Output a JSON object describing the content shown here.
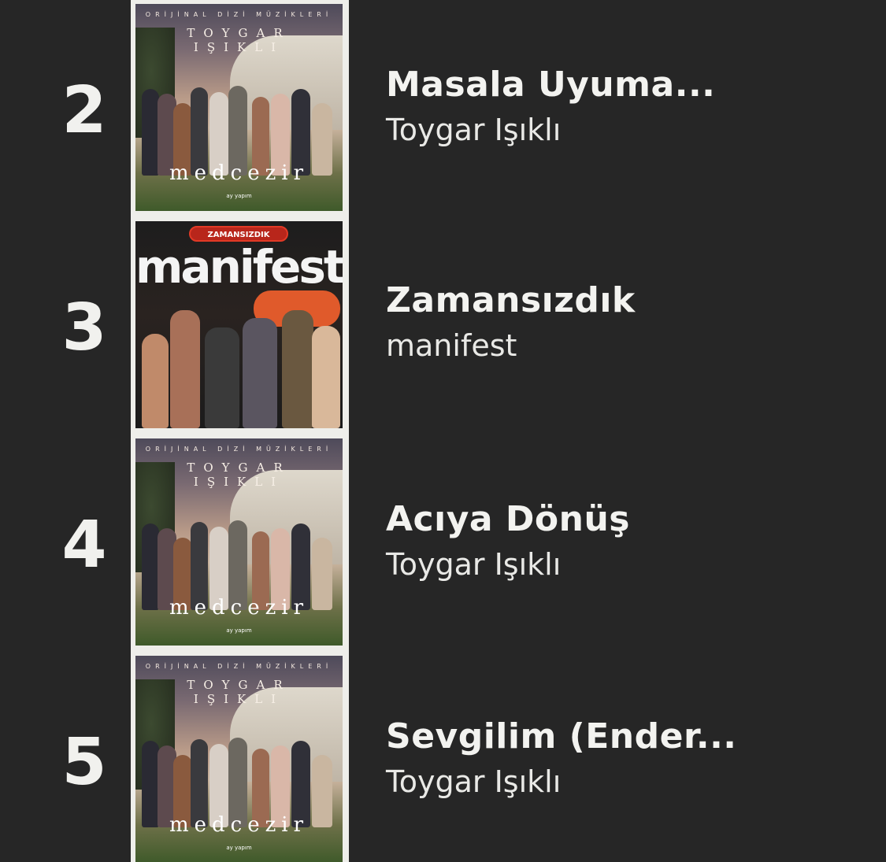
{
  "chart_rows": [
    {
      "rank": "2",
      "title": "Masala Uyuma...",
      "artist": "Toygar Işıklı",
      "art": {
        "subtitle": "ORİJİNAL DİZİ MÜZİKLERİ",
        "name": "TOYGAR IŞIKLI",
        "logo": "medcezir",
        "small": "ay yapım"
      }
    },
    {
      "rank": "3",
      "title": "Zamansızdık",
      "artist": "manifest",
      "art": {
        "pill": "ZAMANSIZDIK",
        "logo": "manifest"
      }
    },
    {
      "rank": "4",
      "title": "Acıya Dönüş",
      "artist": "Toygar Işıklı",
      "art": {
        "subtitle": "ORİJİNAL DİZİ MÜZİKLERİ",
        "name": "TOYGAR IŞIKLI",
        "logo": "medcezir",
        "small": "ay yapım"
      }
    },
    {
      "rank": "5",
      "title": "Sevgilim (Ender...",
      "artist": "Toygar Işıklı",
      "art": {
        "subtitle": "ORİJİNAL DİZİ MÜZİKLERİ",
        "name": "TOYGAR IŞIKLI",
        "logo": "medcezir",
        "small": "ay yapım"
      }
    }
  ],
  "colors": {
    "background": "#262626",
    "strip": "#eeeeea",
    "text": "#f3f3f0"
  }
}
